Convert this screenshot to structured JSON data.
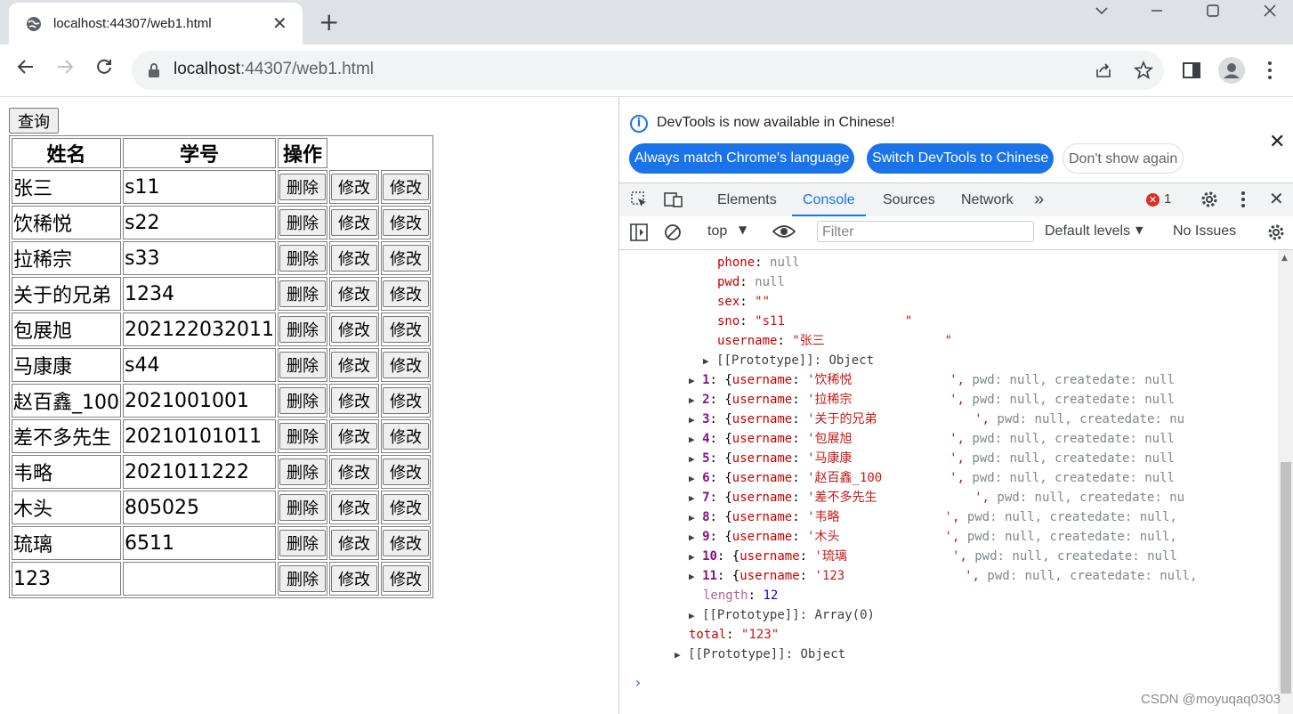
{
  "browser": {
    "tab_title": "localhost:44307/web1.html",
    "url_host": "localhost",
    "url_rest": ":44307/web1.html"
  },
  "page": {
    "query_button": "查询",
    "headers": [
      "姓名",
      "学号",
      "操作"
    ],
    "delete_label": "删除",
    "edit_label": "修改",
    "rows": [
      {
        "name": "张三",
        "sno": "s11"
      },
      {
        "name": "饮稀悦",
        "sno": "s22"
      },
      {
        "name": "拉稀宗",
        "sno": "s33"
      },
      {
        "name": "关于的兄弟",
        "sno": "1234"
      },
      {
        "name": "包展旭",
        "sno": "20212203201​1"
      },
      {
        "name": "马康康",
        "sno": "s44"
      },
      {
        "name": "赵百鑫_100",
        "sno": "2021001001"
      },
      {
        "name": "差不多先生",
        "sno": "20210101011"
      },
      {
        "name": "韦略",
        "sno": "2021011222"
      },
      {
        "name": "木头",
        "sno": "805025"
      },
      {
        "name": "琉璃",
        "sno": "6511"
      },
      {
        "name": "123",
        "sno": ""
      }
    ]
  },
  "devtools": {
    "info_text": "DevTools is now available in Chinese!",
    "btn_match": "Always match Chrome's language",
    "btn_switch": "Switch DevTools to Chinese",
    "btn_dont_show": "Don't show again",
    "tabs": [
      "Elements",
      "Console",
      "Sources",
      "Network"
    ],
    "error_count": "1",
    "context": "top",
    "filter_placeholder": "Filter",
    "levels": "Default levels",
    "issues": "No Issues",
    "console_lines": {
      "phone_key": "phone",
      "phone_val": "null",
      "pwd_key": "pwd",
      "pwd_val": "null",
      "sex_key": "sex",
      "sex_val": "\"\"",
      "sno_key": "sno",
      "sno_val": "\"s11                \"",
      "username_key": "username",
      "username_val": "\"张三                \"",
      "proto1": "[[Prototype]]: Object",
      "length_key": "length",
      "length_val": "12",
      "proto_array": "[[Prototype]]: Array(0)",
      "total_key": "total",
      "total_val": "\"123\"",
      "proto2": "[[Prototype]]: Object"
    },
    "entries": [
      {
        "idx": "1",
        "name": "'饮稀悦",
        "pad": "             ', ",
        "tail": "pwd: null, createdate: null"
      },
      {
        "idx": "2",
        "name": "'拉稀宗",
        "pad": "             ', ",
        "tail": "pwd: null, createdate: null"
      },
      {
        "idx": "3",
        "name": "'关于的兄弟",
        "pad": "             ', ",
        "tail": "pwd: null, createdate: nu"
      },
      {
        "idx": "4",
        "name": "'包展旭",
        "pad": "             ', ",
        "tail": "pwd: null, createdate: null"
      },
      {
        "idx": "5",
        "name": "'马康康",
        "pad": "             ', ",
        "tail": "pwd: null, createdate: null"
      },
      {
        "idx": "6",
        "name": "'赵百鑫_100",
        "pad": "         ', ",
        "tail": "pwd: null, createdate: null"
      },
      {
        "idx": "7",
        "name": "'差不多先生",
        "pad": "             ', ",
        "tail": "pwd: null, createdate: nu"
      },
      {
        "idx": "8",
        "name": "'韦略",
        "pad": "              ', ",
        "tail": "pwd: null, createdate: null,"
      },
      {
        "idx": "9",
        "name": "'木头",
        "pad": "              ', ",
        "tail": "pwd: null, createdate: null,"
      },
      {
        "idx": "10",
        "name": "'琉璃",
        "pad": "              ', ",
        "tail": "pwd: null, createdate: null"
      },
      {
        "idx": "11",
        "name": "'123",
        "pad": "                ', ",
        "tail": "pwd: null, createdate: null,"
      }
    ]
  },
  "watermark": "CSDN @moyuqaq0303"
}
